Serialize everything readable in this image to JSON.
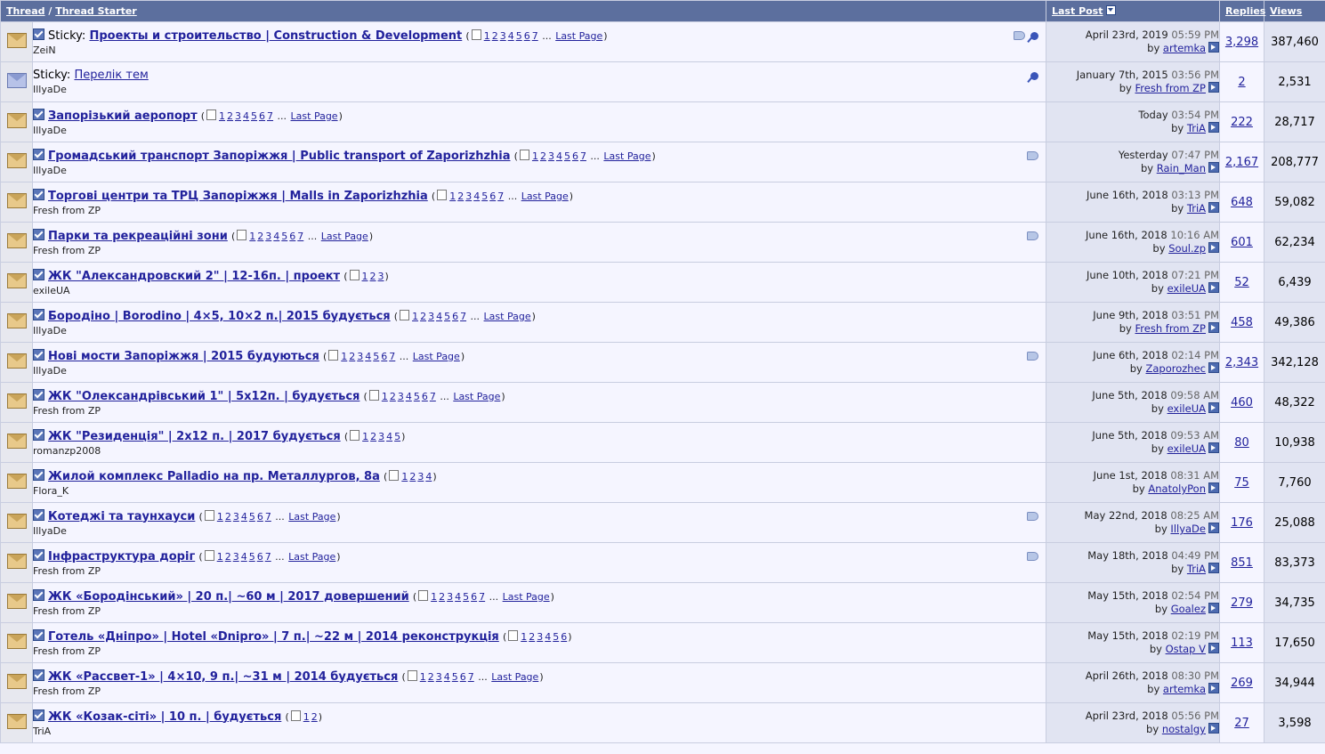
{
  "header": {
    "thread": "Thread",
    "separator": " / ",
    "thread_starter": "Thread Starter",
    "last_post": "Last Post",
    "replies": "Replies",
    "views": "Views"
  },
  "labels": {
    "sticky": "Sticky:",
    "last_page": "Last Page",
    "by": "by"
  },
  "threads": [
    {
      "sticky": true,
      "unread": true,
      "title": "Проекты и строительство | Construction & Development",
      "starter": "ZeiN",
      "pages": [
        "1",
        "2",
        "3",
        "4",
        "5",
        "6",
        "7"
      ],
      "more": true,
      "tag": true,
      "pin": true,
      "date": "April 23rd, 2019",
      "time": "05:59 PM",
      "last_by": "artemka",
      "replies": "3,298",
      "views": "387,460"
    },
    {
      "sticky": true,
      "unread": false,
      "title": "Перелік тем",
      "starter": "IllyaDe",
      "pages": [],
      "more": false,
      "tag": false,
      "pin": true,
      "date": "January 7th, 2015",
      "time": "03:56 PM",
      "last_by": "Fresh from ZP",
      "replies": "2",
      "views": "2,531"
    },
    {
      "sticky": false,
      "unread": true,
      "title": "Запорізький аеропорт",
      "starter": "IllyaDe",
      "pages": [
        "1",
        "2",
        "3",
        "4",
        "5",
        "6",
        "7"
      ],
      "more": true,
      "tag": false,
      "pin": false,
      "date": "Today",
      "time": "03:54 PM",
      "last_by": "TriA",
      "replies": "222",
      "views": "28,717"
    },
    {
      "sticky": false,
      "unread": true,
      "title": "Громадський транспорт Запоріжжя | Public transport of Zaporizhzhia",
      "starter": "IllyaDe",
      "pages": [
        "1",
        "2",
        "3",
        "4",
        "5",
        "6",
        "7"
      ],
      "more": true,
      "tag": true,
      "pin": false,
      "date": "Yesterday",
      "time": "07:47 PM",
      "last_by": "Rain_Man",
      "replies": "2,167",
      "views": "208,777"
    },
    {
      "sticky": false,
      "unread": true,
      "title": "Торгові центри та ТРЦ Запоріжжя | Malls in Zaporizhzhia",
      "starter": "Fresh from ZP",
      "pages": [
        "1",
        "2",
        "3",
        "4",
        "5",
        "6",
        "7"
      ],
      "more": true,
      "tag": false,
      "pin": false,
      "date": "June 16th, 2018",
      "time": "03:13 PM",
      "last_by": "TriA",
      "replies": "648",
      "views": "59,082"
    },
    {
      "sticky": false,
      "unread": true,
      "title": "Парки та рекреаційні зони",
      "starter": "Fresh from ZP",
      "pages": [
        "1",
        "2",
        "3",
        "4",
        "5",
        "6",
        "7"
      ],
      "more": true,
      "tag": true,
      "pin": false,
      "date": "June 16th, 2018",
      "time": "10:16 AM",
      "last_by": "Soul.zp",
      "replies": "601",
      "views": "62,234"
    },
    {
      "sticky": false,
      "unread": true,
      "title": "ЖК \"Александровский 2\" | 12-16п. | проект",
      "starter": "exileUA",
      "pages": [
        "1",
        "2",
        "3"
      ],
      "more": false,
      "tag": false,
      "pin": false,
      "date": "June 10th, 2018",
      "time": "07:21 PM",
      "last_by": "exileUA",
      "replies": "52",
      "views": "6,439"
    },
    {
      "sticky": false,
      "unread": true,
      "title": "Бородіно | Borodino | 4×5, 10×2 п.| 2015 будується",
      "starter": "IllyaDe",
      "pages": [
        "1",
        "2",
        "3",
        "4",
        "5",
        "6",
        "7"
      ],
      "more": true,
      "tag": false,
      "pin": false,
      "date": "June 9th, 2018",
      "time": "03:51 PM",
      "last_by": "Fresh from ZP",
      "replies": "458",
      "views": "49,386"
    },
    {
      "sticky": false,
      "unread": true,
      "title": "Нові мости Запоріжжя | 2015 будуються",
      "starter": "IllyaDe",
      "pages": [
        "1",
        "2",
        "3",
        "4",
        "5",
        "6",
        "7"
      ],
      "more": true,
      "tag": true,
      "pin": false,
      "date": "June 6th, 2018",
      "time": "02:14 PM",
      "last_by": "Zaporozhec",
      "replies": "2,343",
      "views": "342,128"
    },
    {
      "sticky": false,
      "unread": true,
      "title": "ЖК \"Олександрівський 1\" | 5x12п. | будується",
      "starter": "Fresh from ZP",
      "pages": [
        "1",
        "2",
        "3",
        "4",
        "5",
        "6",
        "7"
      ],
      "more": true,
      "tag": false,
      "pin": false,
      "date": "June 5th, 2018",
      "time": "09:58 AM",
      "last_by": "exileUA",
      "replies": "460",
      "views": "48,322"
    },
    {
      "sticky": false,
      "unread": true,
      "title": "ЖК \"Резиденція\" | 2x12 п. | 2017 будується",
      "starter": "romanzp2008",
      "pages": [
        "1",
        "2",
        "3",
        "4",
        "5"
      ],
      "more": false,
      "tag": false,
      "pin": false,
      "date": "June 5th, 2018",
      "time": "09:53 AM",
      "last_by": "exileUA",
      "replies": "80",
      "views": "10,938"
    },
    {
      "sticky": false,
      "unread": true,
      "title": "Жилой комплекс Palladio на пр. Металлургов, 8а",
      "starter": "Flora_K",
      "pages": [
        "1",
        "2",
        "3",
        "4"
      ],
      "more": false,
      "tag": false,
      "pin": false,
      "date": "June 1st, 2018",
      "time": "08:31 AM",
      "last_by": "AnatolyPon",
      "replies": "75",
      "views": "7,760"
    },
    {
      "sticky": false,
      "unread": true,
      "title": "Котеджі та таунхауси",
      "starter": "IllyaDe",
      "pages": [
        "1",
        "2",
        "3",
        "4",
        "5",
        "6",
        "7"
      ],
      "more": true,
      "tag": true,
      "pin": false,
      "date": "May 22nd, 2018",
      "time": "08:25 AM",
      "last_by": "IllyaDe",
      "replies": "176",
      "views": "25,088"
    },
    {
      "sticky": false,
      "unread": true,
      "title": "Інфраструктура доріг",
      "starter": "Fresh from ZP",
      "pages": [
        "1",
        "2",
        "3",
        "4",
        "5",
        "6",
        "7"
      ],
      "more": true,
      "tag": true,
      "pin": false,
      "date": "May 18th, 2018",
      "time": "04:49 PM",
      "last_by": "TriA",
      "replies": "851",
      "views": "83,373"
    },
    {
      "sticky": false,
      "unread": true,
      "title": "ЖК «Бородінський» | 20 п.| ~60 м | 2017 довершений",
      "starter": "Fresh from ZP",
      "pages": [
        "1",
        "2",
        "3",
        "4",
        "5",
        "6",
        "7"
      ],
      "more": true,
      "tag": false,
      "pin": false,
      "date": "May 15th, 2018",
      "time": "02:54 PM",
      "last_by": "Goalez",
      "replies": "279",
      "views": "34,735"
    },
    {
      "sticky": false,
      "unread": true,
      "title": "Готель «Дніпро» | Hotel «Dnipro» | 7 п.| ~22 м | 2014 реконструкція",
      "starter": "Fresh from ZP",
      "pages": [
        "1",
        "2",
        "3",
        "4",
        "5",
        "6"
      ],
      "more": false,
      "tag": false,
      "pin": false,
      "date": "May 15th, 2018",
      "time": "02:19 PM",
      "last_by": "Ostap V",
      "replies": "113",
      "views": "17,650"
    },
    {
      "sticky": false,
      "unread": true,
      "title": "ЖК «Рассвет-1» | 4×10, 9 п.| ~31 м | 2014 будується",
      "starter": "Fresh from ZP",
      "pages": [
        "1",
        "2",
        "3",
        "4",
        "5",
        "6",
        "7"
      ],
      "more": true,
      "tag": false,
      "pin": false,
      "date": "April 26th, 2018",
      "time": "08:30 PM",
      "last_by": "artemka",
      "replies": "269",
      "views": "34,944"
    },
    {
      "sticky": false,
      "unread": true,
      "title": "ЖК «Козак-сіті» | 10 п. | будується",
      "starter": "TriA",
      "pages": [
        "1",
        "2"
      ],
      "more": false,
      "tag": false,
      "pin": false,
      "date": "April 23rd, 2018",
      "time": "05:56 PM",
      "last_by": "nostalgy",
      "replies": "27",
      "views": "3,598"
    }
  ]
}
